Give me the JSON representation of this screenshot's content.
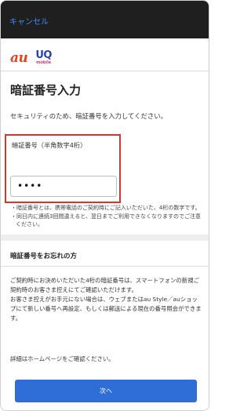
{
  "header": {
    "cancel_label": "キャンセル"
  },
  "brand": {
    "au_logo": "au",
    "uq_logo": "UQ",
    "uq_sub": "mobile"
  },
  "page": {
    "title": "暗証番号入力",
    "lead": "セキュリティのため、暗証番号を入力してください。"
  },
  "pin": {
    "label": "暗証番号（半角数字4桁）",
    "value": "••••"
  },
  "notes": [
    "・暗証番号とは、携帯電話のご契約時にご記入いただいた、4桁の数字です。",
    "・同日内に連続3回間違えると、翌日までご利用できなくなりますのでご注意ください。"
  ],
  "forgot": {
    "title": "暗証番号をお忘れの方",
    "body1": "ご契約時にお決めいただいた4桁の暗証番号は、スマートフォンの新規ご契約時のお客さま控えにてご確認いただけます。",
    "body2": "お客さま控えがお手元にない場合は、ウェブまたはau Style／auショップにて新しい番号へ再設定、もしくは郵送による現在の番号照会ができます。",
    "detail": "詳細はホームページをご確認ください。"
  },
  "actions": {
    "next_label": "次へ"
  },
  "colors": {
    "accent": "#2f6ed6",
    "highlight_border": "#d8342a",
    "cancel_link": "#3d8df5"
  }
}
